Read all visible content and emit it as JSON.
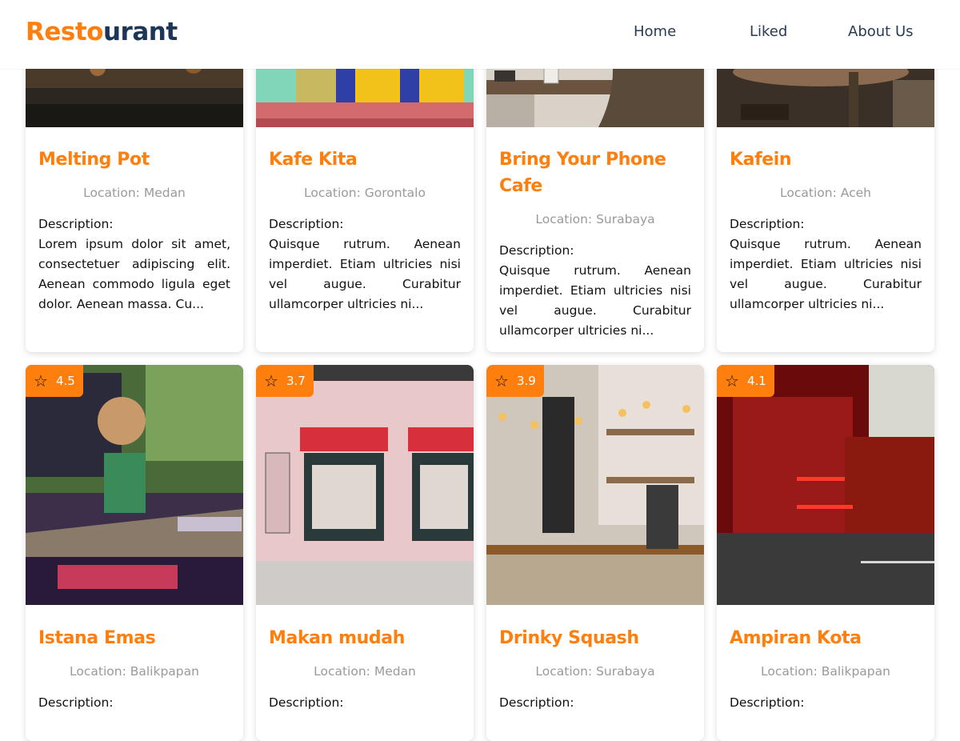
{
  "header": {
    "logo_part1": "Resto",
    "logo_part2": "urant",
    "nav": {
      "home": "Home",
      "liked": "Liked",
      "about": "About Us"
    }
  },
  "labels": {
    "description": "Description:"
  },
  "colors": {
    "accent": "#ff7f0e",
    "brand_dark": "#1d3557"
  },
  "restaurants_row1": [
    {
      "name": "Melting Pot",
      "location": "Location: Medan",
      "description": "Lorem ipsum dolor sit amet, consectetuer adipiscing elit. Aenean commodo ligula eget dolor. Aenean massa. Cu..."
    },
    {
      "name": "Kafe Kita",
      "location": "Location: Gorontalo",
      "description": "Quisque rutrum. Aenean imperdiet. Etiam ultricies nisi vel augue. Curabitur ullamcorper ultricies ni..."
    },
    {
      "name": "Bring Your Phone Cafe",
      "location": "Location: Surabaya",
      "description": "Quisque rutrum. Aenean imperdiet. Etiam ultricies nisi vel augue. Curabitur ullamcorper ultricies ni..."
    },
    {
      "name": "Kafein",
      "location": "Location: Aceh",
      "description": "Quisque rutrum. Aenean imperdiet. Etiam ultricies nisi vel augue. Curabitur ullamcorper ultricies ni..."
    }
  ],
  "restaurants_row2": [
    {
      "name": "Istana Emas",
      "rating": "4.5",
      "location": "Location: Balikpapan"
    },
    {
      "name": "Makan mudah",
      "rating": "3.7",
      "location": "Location: Medan"
    },
    {
      "name": "Drinky Squash",
      "rating": "3.9",
      "location": "Location: Surabaya"
    },
    {
      "name": "Ampiran Kota",
      "rating": "4.1",
      "location": "Location: Balikpapan"
    }
  ]
}
